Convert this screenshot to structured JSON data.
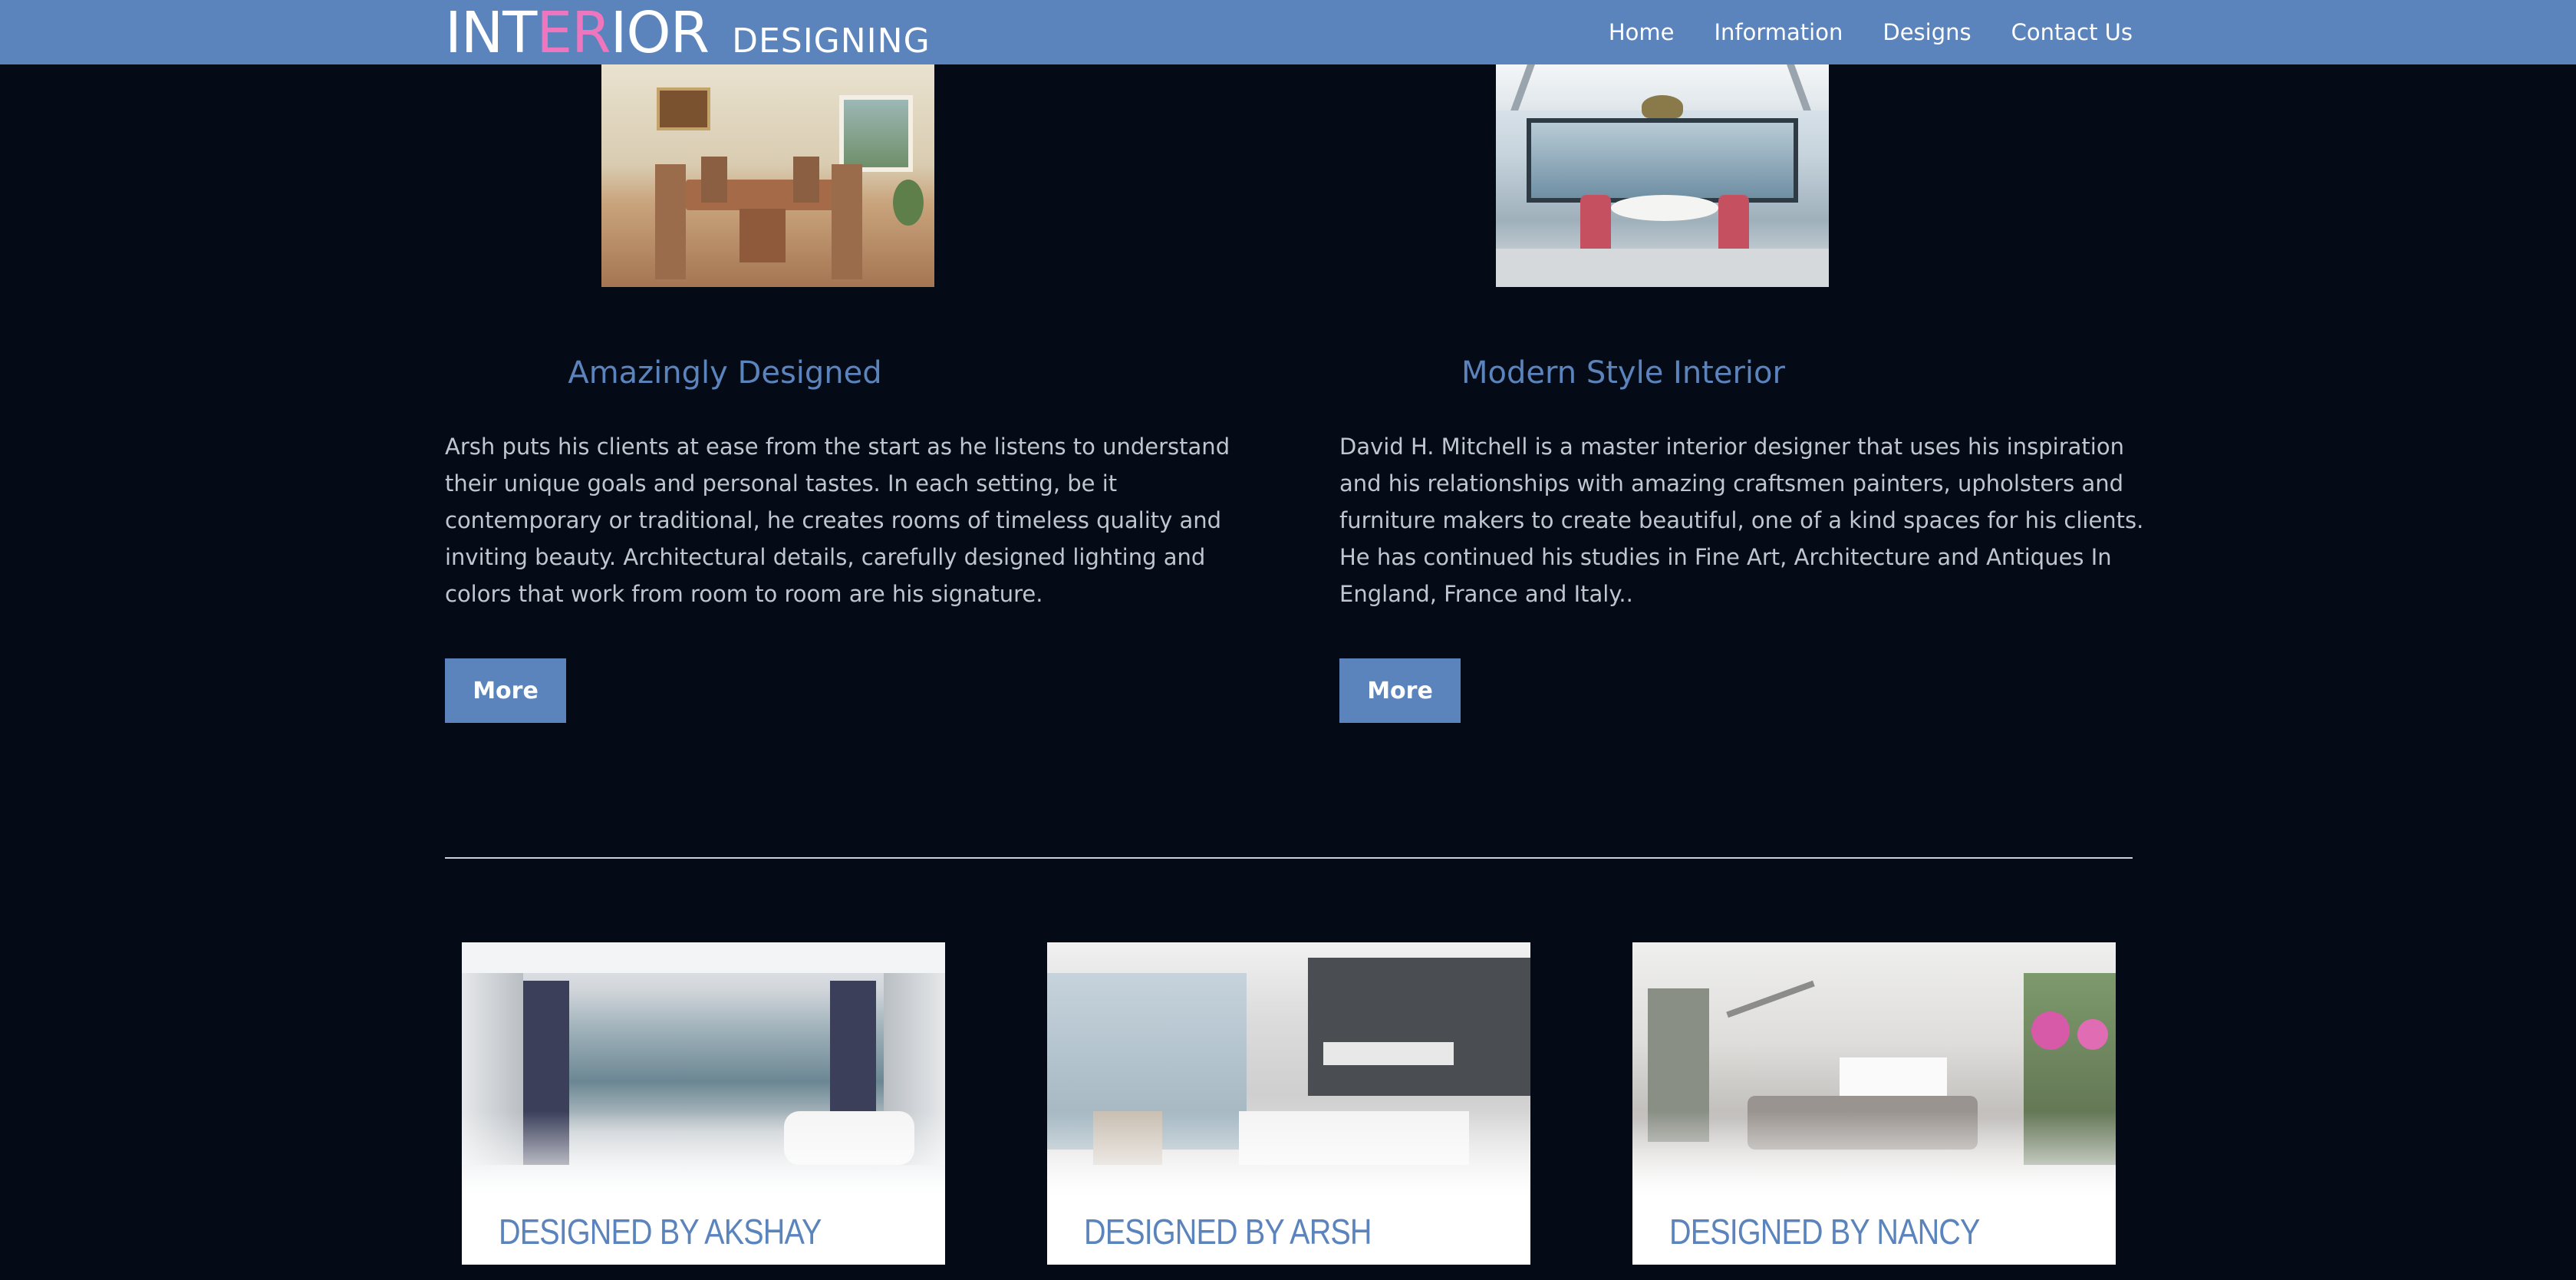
{
  "brand": {
    "logo_prefix": "INT",
    "logo_accent": "ER",
    "logo_suffix": "IOR",
    "logo_sub": "DESIGNING",
    "accent_color": "#ee76be"
  },
  "nav": {
    "items": [
      "Home",
      "Information",
      "Designs",
      "Contact Us"
    ]
  },
  "features": [
    {
      "title": "Amazingly Designed",
      "text": "Arsh puts his clients at ease from the start as he listens to understand their unique goals and personal tastes. In each setting, be it contemporary or traditional, he creates rooms of timeless quality and inviting beauty. Architectural details, carefully designed lighting and colors that work from room to room are his signature.",
      "button": "More"
    },
    {
      "title": "Modern Style Interior",
      "text": "David H. Mitchell is a master interior designer that uses his inspiration and his relationships with amazing craftsmen painters, upholsters and furniture makers to create beautiful, one of a kind spaces for his clients. He has continued his studies in Fine Art, Architecture and Antiques In England, France and Italy..",
      "button": "More"
    }
  ],
  "designers": [
    {
      "title": "DESIGNED BY AKSHAY"
    },
    {
      "title": "DESIGNED BY ARSH"
    },
    {
      "title": "DESIGNED BY NANCY"
    }
  ],
  "colors": {
    "primary": "#5b84bd",
    "background": "#050b16",
    "body_text": "#bfc6cf"
  }
}
